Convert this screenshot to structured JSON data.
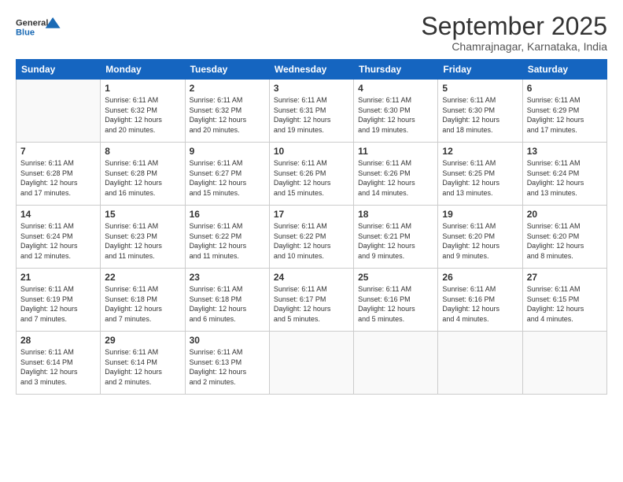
{
  "logo": {
    "line1": "General",
    "line2": "Blue"
  },
  "title": "September 2025",
  "subtitle": "Chamrajnagar, Karnataka, India",
  "headers": [
    "Sunday",
    "Monday",
    "Tuesday",
    "Wednesday",
    "Thursday",
    "Friday",
    "Saturday"
  ],
  "weeks": [
    [
      {
        "day": "",
        "info": ""
      },
      {
        "day": "1",
        "info": "Sunrise: 6:11 AM\nSunset: 6:32 PM\nDaylight: 12 hours\nand 20 minutes."
      },
      {
        "day": "2",
        "info": "Sunrise: 6:11 AM\nSunset: 6:32 PM\nDaylight: 12 hours\nand 20 minutes."
      },
      {
        "day": "3",
        "info": "Sunrise: 6:11 AM\nSunset: 6:31 PM\nDaylight: 12 hours\nand 19 minutes."
      },
      {
        "day": "4",
        "info": "Sunrise: 6:11 AM\nSunset: 6:30 PM\nDaylight: 12 hours\nand 19 minutes."
      },
      {
        "day": "5",
        "info": "Sunrise: 6:11 AM\nSunset: 6:30 PM\nDaylight: 12 hours\nand 18 minutes."
      },
      {
        "day": "6",
        "info": "Sunrise: 6:11 AM\nSunset: 6:29 PM\nDaylight: 12 hours\nand 17 minutes."
      }
    ],
    [
      {
        "day": "7",
        "info": "Sunrise: 6:11 AM\nSunset: 6:28 PM\nDaylight: 12 hours\nand 17 minutes."
      },
      {
        "day": "8",
        "info": "Sunrise: 6:11 AM\nSunset: 6:28 PM\nDaylight: 12 hours\nand 16 minutes."
      },
      {
        "day": "9",
        "info": "Sunrise: 6:11 AM\nSunset: 6:27 PM\nDaylight: 12 hours\nand 15 minutes."
      },
      {
        "day": "10",
        "info": "Sunrise: 6:11 AM\nSunset: 6:26 PM\nDaylight: 12 hours\nand 15 minutes."
      },
      {
        "day": "11",
        "info": "Sunrise: 6:11 AM\nSunset: 6:26 PM\nDaylight: 12 hours\nand 14 minutes."
      },
      {
        "day": "12",
        "info": "Sunrise: 6:11 AM\nSunset: 6:25 PM\nDaylight: 12 hours\nand 13 minutes."
      },
      {
        "day": "13",
        "info": "Sunrise: 6:11 AM\nSunset: 6:24 PM\nDaylight: 12 hours\nand 13 minutes."
      }
    ],
    [
      {
        "day": "14",
        "info": "Sunrise: 6:11 AM\nSunset: 6:24 PM\nDaylight: 12 hours\nand 12 minutes."
      },
      {
        "day": "15",
        "info": "Sunrise: 6:11 AM\nSunset: 6:23 PM\nDaylight: 12 hours\nand 11 minutes."
      },
      {
        "day": "16",
        "info": "Sunrise: 6:11 AM\nSunset: 6:22 PM\nDaylight: 12 hours\nand 11 minutes."
      },
      {
        "day": "17",
        "info": "Sunrise: 6:11 AM\nSunset: 6:22 PM\nDaylight: 12 hours\nand 10 minutes."
      },
      {
        "day": "18",
        "info": "Sunrise: 6:11 AM\nSunset: 6:21 PM\nDaylight: 12 hours\nand 9 minutes."
      },
      {
        "day": "19",
        "info": "Sunrise: 6:11 AM\nSunset: 6:20 PM\nDaylight: 12 hours\nand 9 minutes."
      },
      {
        "day": "20",
        "info": "Sunrise: 6:11 AM\nSunset: 6:20 PM\nDaylight: 12 hours\nand 8 minutes."
      }
    ],
    [
      {
        "day": "21",
        "info": "Sunrise: 6:11 AM\nSunset: 6:19 PM\nDaylight: 12 hours\nand 7 minutes."
      },
      {
        "day": "22",
        "info": "Sunrise: 6:11 AM\nSunset: 6:18 PM\nDaylight: 12 hours\nand 7 minutes."
      },
      {
        "day": "23",
        "info": "Sunrise: 6:11 AM\nSunset: 6:18 PM\nDaylight: 12 hours\nand 6 minutes."
      },
      {
        "day": "24",
        "info": "Sunrise: 6:11 AM\nSunset: 6:17 PM\nDaylight: 12 hours\nand 5 minutes."
      },
      {
        "day": "25",
        "info": "Sunrise: 6:11 AM\nSunset: 6:16 PM\nDaylight: 12 hours\nand 5 minutes."
      },
      {
        "day": "26",
        "info": "Sunrise: 6:11 AM\nSunset: 6:16 PM\nDaylight: 12 hours\nand 4 minutes."
      },
      {
        "day": "27",
        "info": "Sunrise: 6:11 AM\nSunset: 6:15 PM\nDaylight: 12 hours\nand 4 minutes."
      }
    ],
    [
      {
        "day": "28",
        "info": "Sunrise: 6:11 AM\nSunset: 6:14 PM\nDaylight: 12 hours\nand 3 minutes."
      },
      {
        "day": "29",
        "info": "Sunrise: 6:11 AM\nSunset: 6:14 PM\nDaylight: 12 hours\nand 2 minutes."
      },
      {
        "day": "30",
        "info": "Sunrise: 6:11 AM\nSunset: 6:13 PM\nDaylight: 12 hours\nand 2 minutes."
      },
      {
        "day": "",
        "info": ""
      },
      {
        "day": "",
        "info": ""
      },
      {
        "day": "",
        "info": ""
      },
      {
        "day": "",
        "info": ""
      }
    ]
  ]
}
